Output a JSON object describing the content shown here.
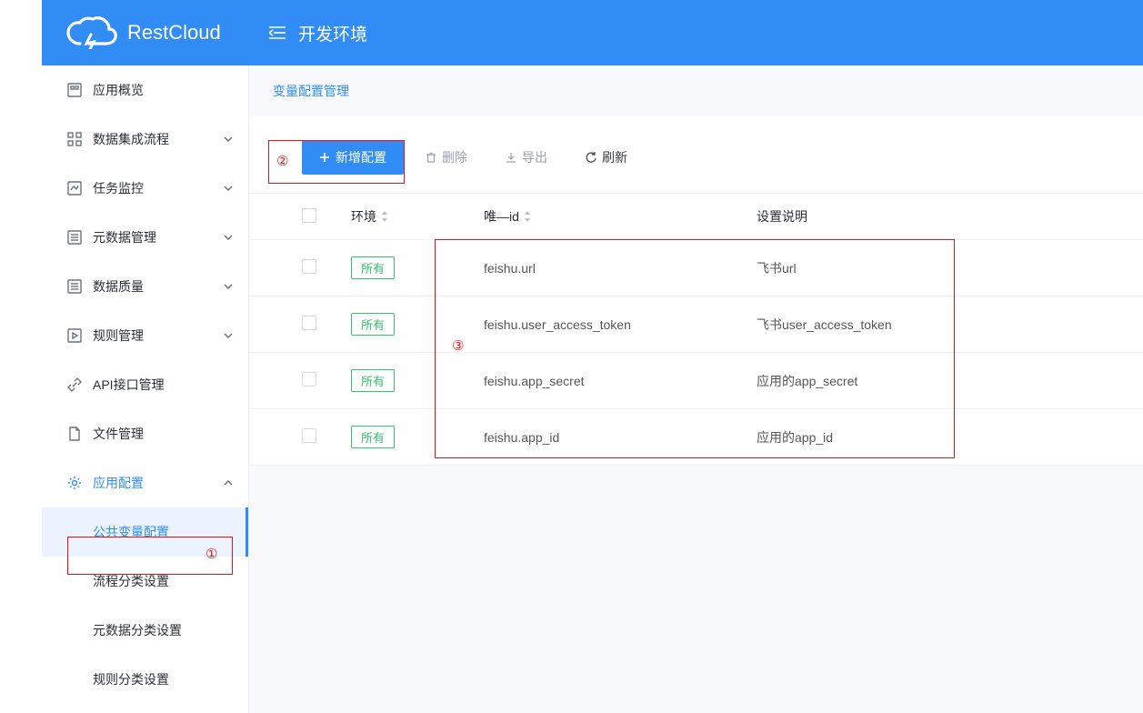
{
  "brand": "RestCloud",
  "env_label": "开发环境",
  "breadcrumb": {
    "label": "变量配置管理"
  },
  "sidebar": {
    "items": [
      {
        "label": "应用概览"
      },
      {
        "label": "数据集成流程"
      },
      {
        "label": "任务监控"
      },
      {
        "label": "元数据管理"
      },
      {
        "label": "数据质量"
      },
      {
        "label": "规则管理"
      },
      {
        "label": "API接口管理"
      },
      {
        "label": "文件管理"
      },
      {
        "label": "应用配置"
      }
    ],
    "sub_items": [
      {
        "label": "公共变量配置"
      },
      {
        "label": "流程分类设置"
      },
      {
        "label": "元数据分类设置"
      },
      {
        "label": "规则分类设置"
      }
    ]
  },
  "toolbar": {
    "add": "新增配置",
    "delete": "删除",
    "export": "导出",
    "refresh": "刷新"
  },
  "table": {
    "head": {
      "env": "环境",
      "id": "唯—id",
      "desc": "设置说明"
    },
    "rows": [
      {
        "env": "所有",
        "id": "feishu.url",
        "desc": "飞书url"
      },
      {
        "env": "所有",
        "id": "feishu.user_access_token",
        "desc": "飞书user_access_token"
      },
      {
        "env": "所有",
        "id": "feishu.app_secret",
        "desc": "应用的app_secret"
      },
      {
        "env": "所有",
        "id": "feishu.app_id",
        "desc": "应用的app_id"
      }
    ]
  },
  "annotations": {
    "a1": "①",
    "a2": "②",
    "a3": "③"
  }
}
